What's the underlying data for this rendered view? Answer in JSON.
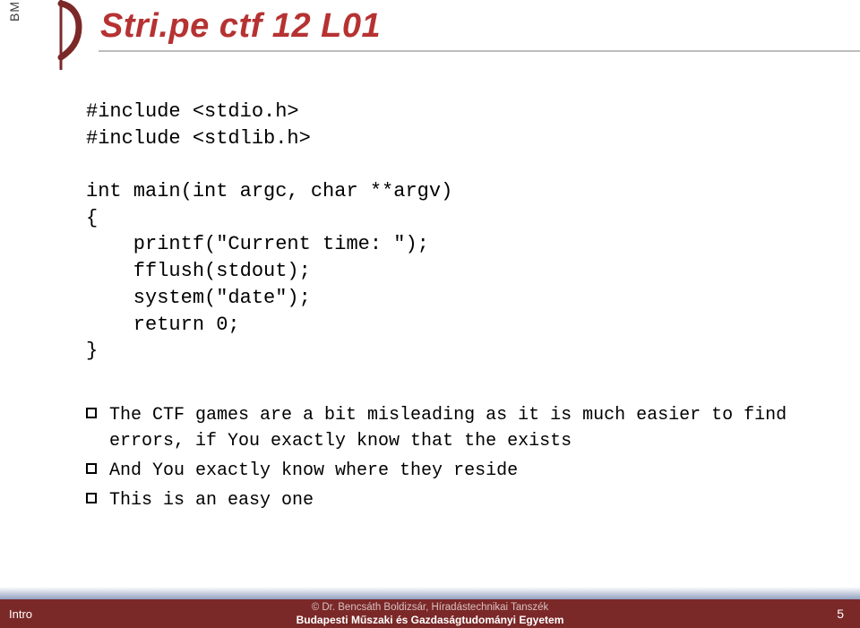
{
  "header": {
    "bme": "BME",
    "title": "Stri.pe ctf 12 L01"
  },
  "code": {
    "l1": "#include <stdio.h>",
    "l2": "#include <stdlib.h>",
    "l3": "",
    "l4": "int main(int argc, char **argv)",
    "l5": "{",
    "l6": "    printf(\"Current time: \");",
    "l7": "    fflush(stdout);",
    "l8": "    system(\"date\");",
    "l9": "    return 0;",
    "l10": "}"
  },
  "bullets": {
    "b1": "The CTF games are a bit misleading as it is much easier to find errors, if You exactly know that the exists",
    "b2": "And You exactly know where they reside",
    "b3": "This is an easy one"
  },
  "footer": {
    "left": "Intro",
    "center1": "©  Dr. Bencsáth Boldizsár, Híradástechnikai Tanszék",
    "center2": "Budapesti Műszaki és Gazdaságtudományi Egyetem",
    "page": "5"
  }
}
